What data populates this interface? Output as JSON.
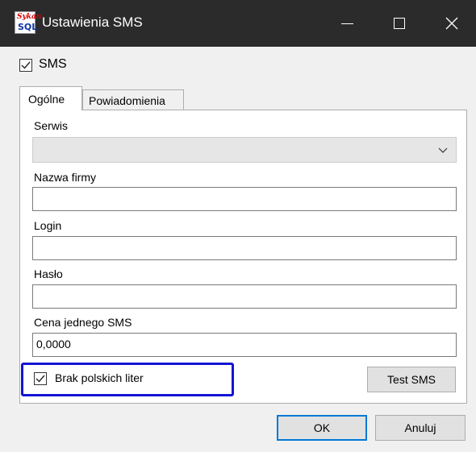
{
  "window": {
    "title": "Ustawienia SMS",
    "icon_name": "app-logo-icon",
    "logo_text_top": "Sykan",
    "logo_text_bottom": "SQL",
    "controls": [
      "minimize-icon",
      "maximize-icon",
      "close-icon"
    ]
  },
  "sms_toggle": {
    "label": "SMS",
    "checked": true
  },
  "tabs": [
    {
      "label": "Ogólne",
      "active": true
    },
    {
      "label": "Powiadomienia",
      "active": false
    }
  ],
  "form": {
    "serwis": {
      "label": "Serwis",
      "value": ""
    },
    "nazwa_firmy": {
      "label": "Nazwa firmy",
      "value": ""
    },
    "login": {
      "label": "Login",
      "value": ""
    },
    "haslo": {
      "label": "Hasło",
      "value": ""
    },
    "cena": {
      "label": "Cena jednego SMS",
      "value": "0,0000"
    },
    "brak_polskich": {
      "label": "Brak polskich liter",
      "checked": true
    },
    "test_button": "Test SMS"
  },
  "footer": {
    "ok_label": "OK",
    "cancel_label": "Anuluj"
  },
  "colors": {
    "titlebar": "#2b2b2b",
    "highlight": "#1414d6",
    "ok_border": "#0078d7"
  }
}
